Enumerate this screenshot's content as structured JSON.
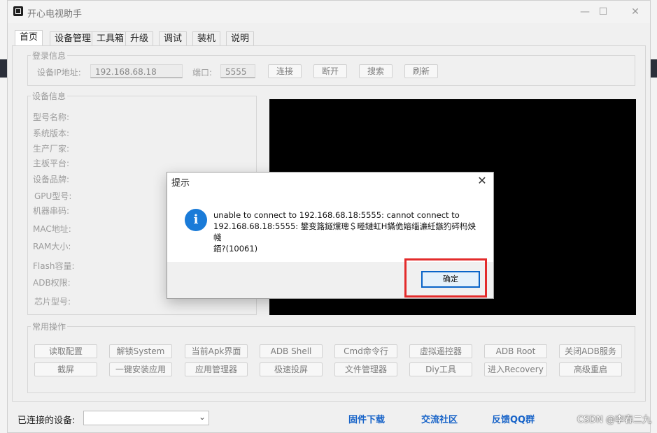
{
  "window": {
    "title": "开心电视助手",
    "controls": {
      "minimize": "—",
      "maximize": "☐",
      "close": "✕"
    }
  },
  "tabs": [
    {
      "label": "首页",
      "active": true
    },
    {
      "label": "设备管理"
    },
    {
      "label": "工具箱"
    },
    {
      "label": "升级"
    },
    {
      "label": "调试"
    },
    {
      "label": "装机"
    },
    {
      "label": "说明"
    }
  ],
  "login": {
    "legend": "登录信息",
    "ip_label": "设备IP地址:",
    "ip_value": "192.168.68.18",
    "port_label": "端口:",
    "port_value": "5555",
    "buttons": {
      "connect": "连接",
      "disconnect": "断开",
      "search": "搜索",
      "refresh": "刷新"
    }
  },
  "device_info": {
    "legend": "设备信息",
    "fields": [
      "型号名称:",
      "系统版本:",
      "生产厂家:",
      "主板平台:",
      "设备品牌:",
      "GPU型号:",
      "机器串码:",
      "MAC地址:",
      "RAM大小:",
      "Flash容量:",
      "ADB权限:",
      "芯片型号:"
    ]
  },
  "ops": {
    "legend": "常用操作",
    "row1": [
      "读取配置",
      "解锁System",
      "当前Apk界面",
      "ADB Shell",
      "Cmd命令行",
      "虚拟遥控器",
      "ADB  Root",
      "关闭ADB服务"
    ],
    "row2": [
      "截屏",
      "一键安装应用",
      "应用管理器",
      "极速投屏",
      "文件管理器",
      "Diy工具",
      "进入Recovery",
      "高级重启"
    ]
  },
  "bottom": {
    "connected_label": "已连接的设备:",
    "select_value": "",
    "links": [
      "固件下载",
      "交流社区",
      "反馈QQ群"
    ]
  },
  "dialog": {
    "title": "提示",
    "close": "✕",
    "icon": "i",
    "message": "unable to connect to 192.168.68.18:5555: cannot connect to\n192.168.68.18:5555: 鐢变簬鐩爣璁＄畻鏈虹Н鏋佹嫆缁濓紝鏃犳硶杩炴帴\n銆?(10061)",
    "ok": "确定"
  },
  "watermark": "CSDN @李春二九"
}
